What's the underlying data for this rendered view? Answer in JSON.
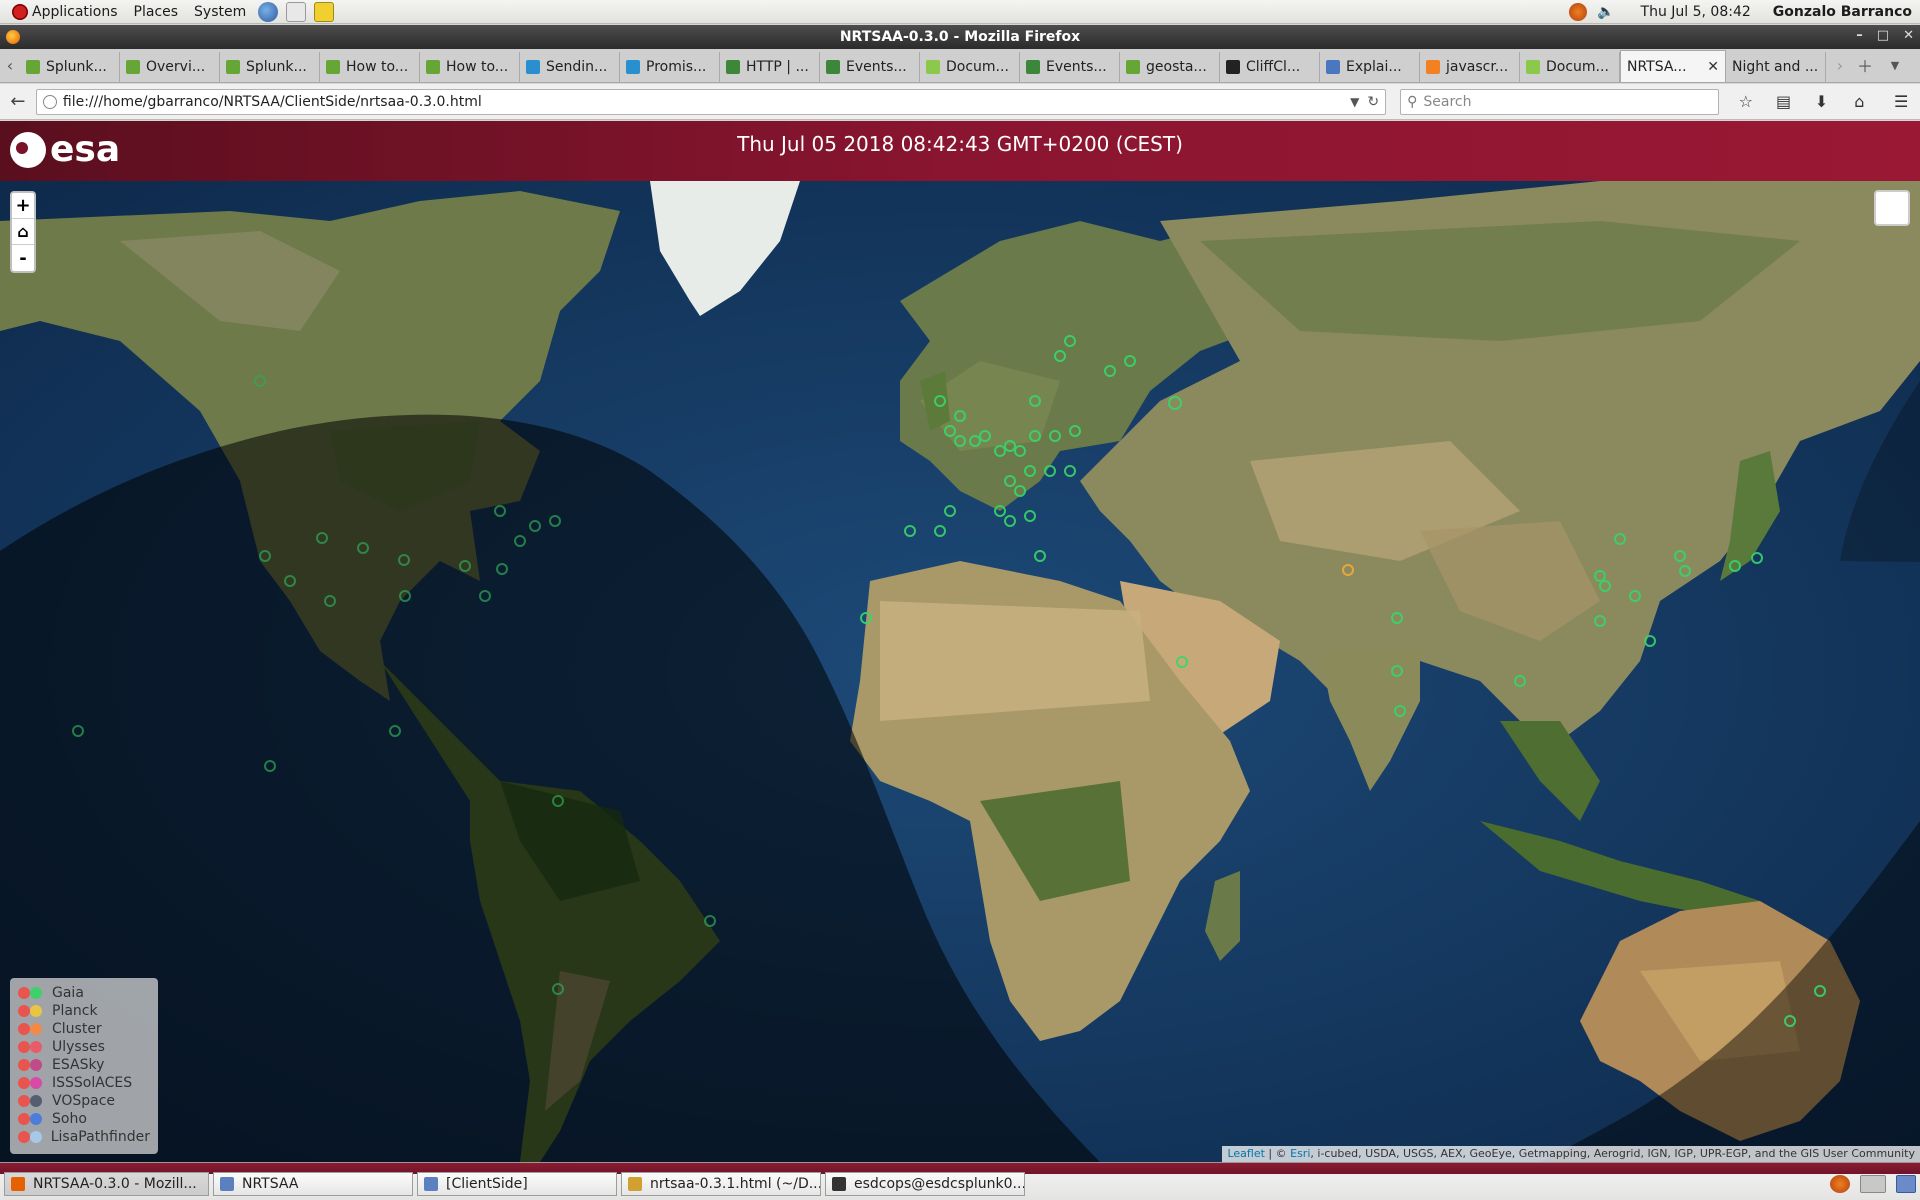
{
  "top_panel": {
    "menus": [
      "Applications",
      "Places",
      "System"
    ],
    "clock": "Thu Jul  5, 08:42",
    "user": "Gonzalo Barranco"
  },
  "window": {
    "title": "NRTSAA-0.3.0 - Mozilla Firefox"
  },
  "tabs": [
    {
      "label": "Splunk...",
      "icon": "splunk-icon",
      "color": "#65a637"
    },
    {
      "label": "Overvi...",
      "icon": "splunk-icon",
      "color": "#65a637"
    },
    {
      "label": "Splunk...",
      "icon": "splunk-icon",
      "color": "#65a637"
    },
    {
      "label": "How to...",
      "icon": "splunk-icon",
      "color": "#65a637"
    },
    {
      "label": "How to...",
      "icon": "splunk-icon",
      "color": "#65a637"
    },
    {
      "label": "Sendin...",
      "icon": "docs-icon",
      "color": "#2a8fcf"
    },
    {
      "label": "Promis...",
      "icon": "docs-icon",
      "color": "#2a8fcf"
    },
    {
      "label": "HTTP | ...",
      "icon": "node-icon",
      "color": "#3c873a"
    },
    {
      "label": "Events...",
      "icon": "node-icon",
      "color": "#3c873a"
    },
    {
      "label": "Docum...",
      "icon": "leaf-icon",
      "color": "#8cc84b"
    },
    {
      "label": "Events...",
      "icon": "node-icon",
      "color": "#3c873a"
    },
    {
      "label": "geosta...",
      "icon": "splunk-icon",
      "color": "#65a637"
    },
    {
      "label": "CliffCl...",
      "icon": "github-icon",
      "color": "#222222"
    },
    {
      "label": "Explai...",
      "icon": "web-icon",
      "color": "#4a78c0"
    },
    {
      "label": "javascr...",
      "icon": "stack-icon",
      "color": "#f48024"
    },
    {
      "label": "Docum...",
      "icon": "leaf-icon",
      "color": "#8cc84b"
    },
    {
      "label": "NRTSA...",
      "icon": "none",
      "color": "",
      "active": true
    },
    {
      "label": "Night and ...",
      "icon": "none",
      "color": ""
    }
  ],
  "navbar": {
    "url": "file:///home/gbarranco/NRTSAA/ClientSide/nrtsaa-0.3.0.html",
    "search_placeholder": "Search"
  },
  "page": {
    "datetime": "Thu Jul 05 2018 08:42:43 GMT+0200 (CEST)",
    "logo_text": "esa"
  },
  "map": {
    "zoom_in": "+",
    "home": "⌂",
    "zoom_out": "-",
    "legend": [
      {
        "label": "Gaia",
        "colors": [
          "#e8544e",
          "#3ed06a"
        ]
      },
      {
        "label": "Planck",
        "colors": [
          "#e8544e",
          "#e8c542"
        ]
      },
      {
        "label": "Cluster",
        "colors": [
          "#e8544e",
          "#f08a4a"
        ]
      },
      {
        "label": "Ulysses",
        "colors": [
          "#e8544e",
          "#e85c6a"
        ]
      },
      {
        "label": "ESASky",
        "colors": [
          "#e8544e",
          "#c04a8a"
        ]
      },
      {
        "label": "ISSSolACES",
        "colors": [
          "#e8544e",
          "#d84aa8"
        ]
      },
      {
        "label": "VOSpace",
        "colors": [
          "#e8544e",
          "#555e70"
        ]
      },
      {
        "label": "Soho",
        "colors": [
          "#e8544e",
          "#4a7ed8"
        ]
      },
      {
        "label": "LisaPathfinder",
        "colors": [
          "#e8544e",
          "#a8c8e8"
        ]
      }
    ],
    "attribution_link1": "Leaflet",
    "attribution_sep": " | © ",
    "attribution_link2": "Esri",
    "attribution_rest": ", i-cubed, USDA, USGS, AEX, GeoEye, Getmapping, Aerogrid, IGN, IGP, UPR-EGP, and the GIS User Community"
  },
  "taskbar": [
    {
      "label": "NRTSAA-0.3.0 - Mozill...",
      "icon": "firefox-icon",
      "active": true
    },
    {
      "label": "NRTSAA",
      "icon": "folder-icon"
    },
    {
      "label": "[ClientSide]",
      "icon": "folder-icon"
    },
    {
      "label": "nrtsaa-0.3.1.html (~/D...",
      "icon": "editor-icon"
    },
    {
      "label": "esdcops@esdcsplunk0...",
      "icon": "terminal-icon"
    }
  ]
}
